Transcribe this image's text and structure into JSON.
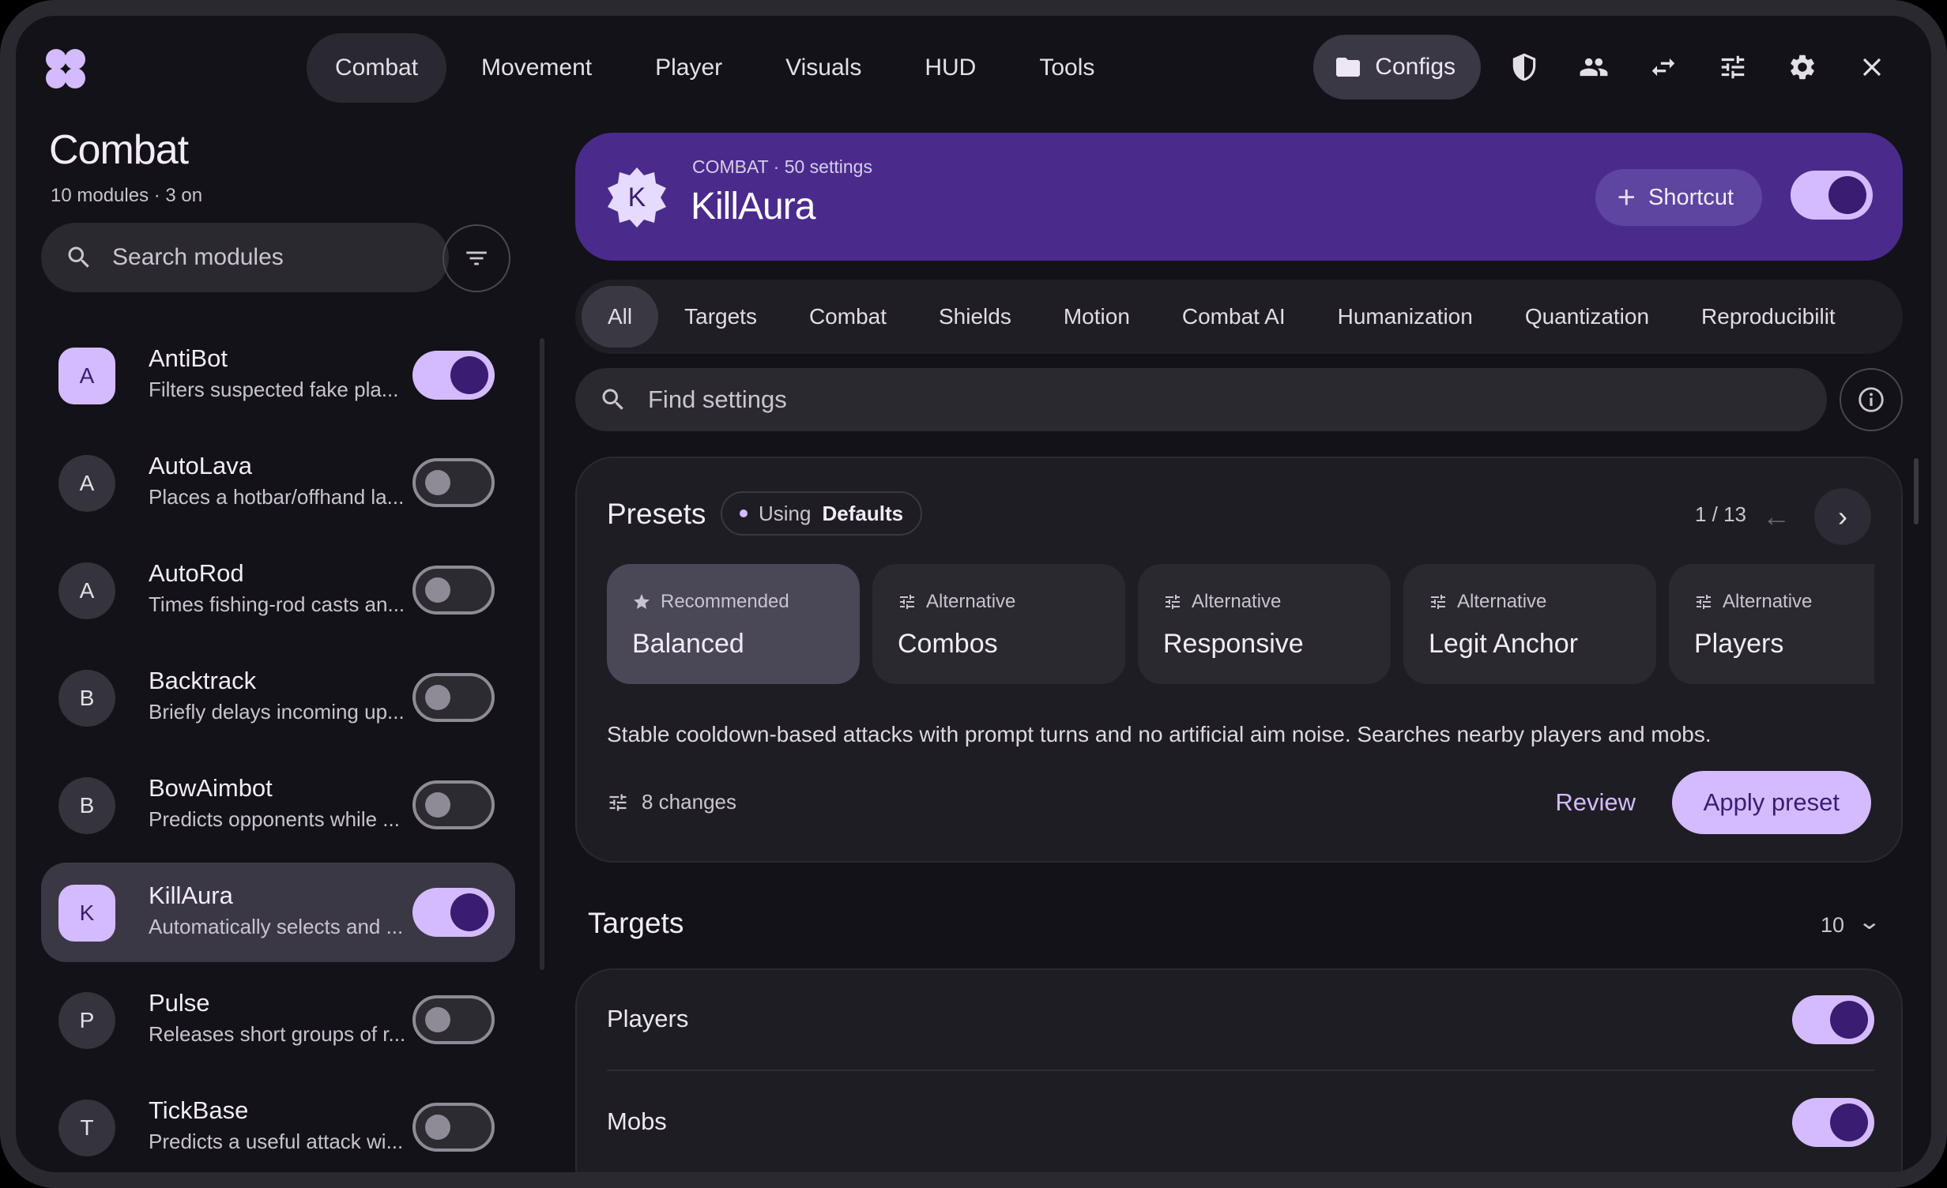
{
  "nav": {
    "tabs": [
      "Combat",
      "Movement",
      "Player",
      "Visuals",
      "HUD",
      "Tools"
    ],
    "active": "Combat",
    "configs_label": "Configs"
  },
  "sidebar": {
    "title": "Combat",
    "subtitle": "10 modules · 3 on",
    "search_placeholder": "Search modules",
    "modules": [
      {
        "initial": "A",
        "name": "AntiBot",
        "desc": "Filters suspected fake pla...",
        "on": true
      },
      {
        "initial": "A",
        "name": "AutoLava",
        "desc": "Places a hotbar/offhand la...",
        "on": false
      },
      {
        "initial": "A",
        "name": "AutoRod",
        "desc": "Times fishing-rod casts an...",
        "on": false
      },
      {
        "initial": "B",
        "name": "Backtrack",
        "desc": "Briefly delays incoming up...",
        "on": false
      },
      {
        "initial": "B",
        "name": "BowAimbot",
        "desc": "Predicts opponents while ...",
        "on": false
      },
      {
        "initial": "K",
        "name": "KillAura",
        "desc": "Automatically selects and ...",
        "on": true,
        "selected": true
      },
      {
        "initial": "P",
        "name": "Pulse",
        "desc": "Releases short groups of r...",
        "on": false
      },
      {
        "initial": "T",
        "name": "TickBase",
        "desc": "Predicts a useful attack wi...",
        "on": false
      }
    ]
  },
  "header": {
    "badge": "K",
    "kicker": "COMBAT · 50 settings",
    "title": "KillAura",
    "shortcut_label": "Shortcut",
    "enabled": true
  },
  "subtabs": [
    "All",
    "Targets",
    "Combat",
    "Shields",
    "Motion",
    "Combat AI",
    "Humanization",
    "Quantization",
    "Reproducibilit"
  ],
  "find_placeholder": "Find settings",
  "presets": {
    "title": "Presets",
    "using_label": "Using",
    "using_value": "Defaults",
    "pager": "1 / 13",
    "cards": [
      {
        "tag": "Recommended",
        "name": "Balanced",
        "icon": "star-icon",
        "active": true
      },
      {
        "tag": "Alternative",
        "name": "Combos",
        "icon": "tune-icon"
      },
      {
        "tag": "Alternative",
        "name": "Responsive",
        "icon": "tune-icon"
      },
      {
        "tag": "Alternative",
        "name": "Legit Anchor",
        "icon": "tune-icon"
      },
      {
        "tag": "Alternative",
        "name": "Players",
        "icon": "tune-icon"
      }
    ],
    "description": "Stable cooldown-based attacks with prompt turns and no artificial aim noise. Searches nearby players and mobs.",
    "changes": "8 changes",
    "review_label": "Review",
    "apply_label": "Apply preset"
  },
  "targets": {
    "title": "Targets",
    "count": "10",
    "settings": [
      {
        "label": "Players",
        "on": true
      },
      {
        "label": "Mobs",
        "on": true
      }
    ]
  },
  "colors": {
    "accent": "#d4bbff",
    "accent_dark": "#3a1d72",
    "banner": "#4a2b8c",
    "background": "#131218"
  }
}
